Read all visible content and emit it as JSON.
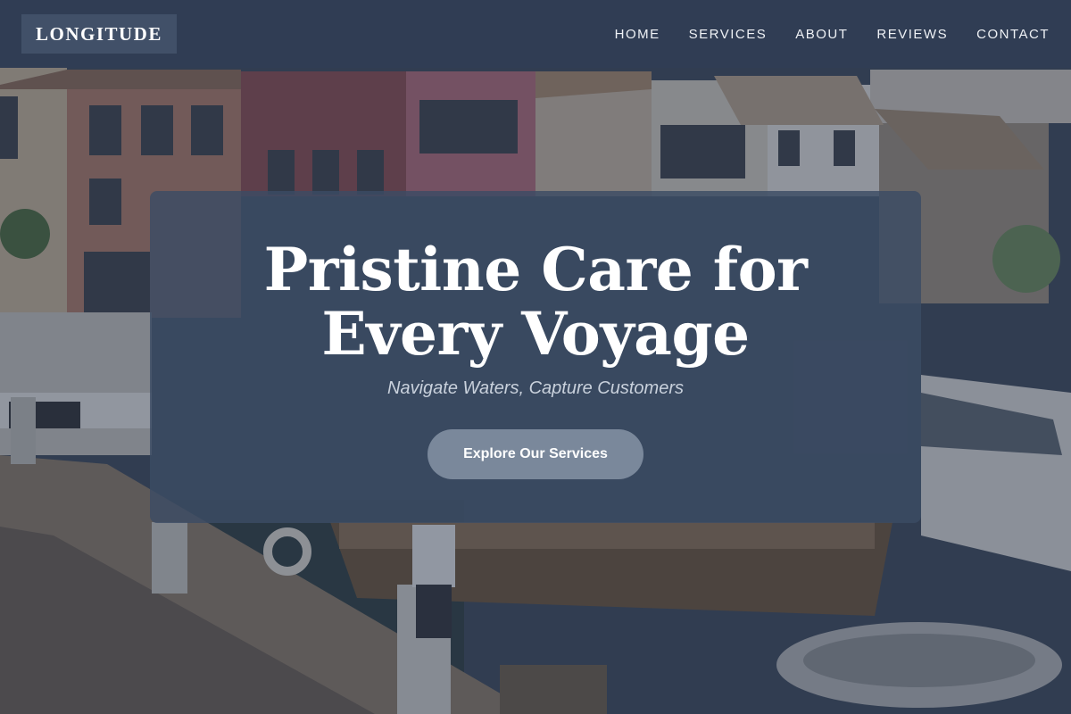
{
  "brand": {
    "logo_text": "LONGITUDE"
  },
  "nav": {
    "items": [
      {
        "label": "HOME"
      },
      {
        "label": "SERVICES"
      },
      {
        "label": "ABOUT"
      },
      {
        "label": "REVIEWS"
      },
      {
        "label": "CONTACT"
      }
    ]
  },
  "hero": {
    "title": "Pristine Care for Every Voyage",
    "subtitle": "Navigate Waters, Capture Customers",
    "cta_label": "Explore Our Services"
  },
  "colors": {
    "header_bg": "#303e54",
    "hero_card_bg": "#3c4c64",
    "cta_bg": "#7a889b",
    "text_primary": "#ffffff",
    "text_muted": "#c9d1dc"
  }
}
